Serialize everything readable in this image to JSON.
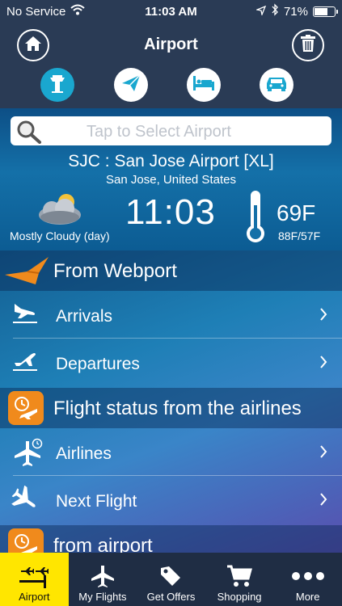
{
  "status_bar": {
    "carrier": "No Service",
    "time": "11:03 AM",
    "battery": "71%",
    "battery_level": 0.71
  },
  "header": {
    "title": "Airport",
    "home_icon": "home-icon",
    "trash_icon": "trash-icon",
    "tabs": [
      {
        "icon": "control-tower-icon",
        "active": true
      },
      {
        "icon": "paper-plane-icon",
        "active": false
      },
      {
        "icon": "hotel-bed-icon",
        "active": false
      },
      {
        "icon": "car-icon",
        "active": false
      }
    ]
  },
  "search": {
    "placeholder": "Tap to Select Airport"
  },
  "airport": {
    "name": "SJC : San Jose Airport [XL]",
    "city": "San Jose, United States",
    "weather": "Mostly Cloudy (day)",
    "local_time": "11:03",
    "temperature": "69F",
    "temperature_range": "88F/57F"
  },
  "menu": {
    "sections": [
      {
        "title": "From Webport",
        "icon": "webport-bird-icon",
        "items": [
          {
            "label": "Arrivals",
            "icon": "arrival-plane-icon"
          },
          {
            "label": "Departures",
            "icon": "departure-plane-icon"
          }
        ]
      },
      {
        "title": "Flight status from the airlines",
        "icon": "flight-clock-icon",
        "items": [
          {
            "label": "Airlines",
            "icon": "airline-plane-clock-icon"
          },
          {
            "label": "Next Flight",
            "icon": "next-flight-plane-icon"
          }
        ]
      },
      {
        "title": "from airport",
        "icon": "flight-clock-icon",
        "items": []
      }
    ]
  },
  "tabbar": {
    "items": [
      {
        "label": "Airport",
        "icon": "airport-icon",
        "active": true
      },
      {
        "label": "My Flights",
        "icon": "airplane-icon",
        "active": false
      },
      {
        "label": "Get Offers",
        "icon": "tag-icon",
        "active": false
      },
      {
        "label": "Shopping",
        "icon": "cart-icon",
        "active": false
      },
      {
        "label": "More",
        "icon": "more-dots-icon",
        "active": false
      }
    ]
  },
  "colors": {
    "header_bg": "#2a3b55",
    "active_tab": "#1aa7cf",
    "orange_icon": "#f08a1c",
    "tabbar_active": "#ffe600"
  }
}
